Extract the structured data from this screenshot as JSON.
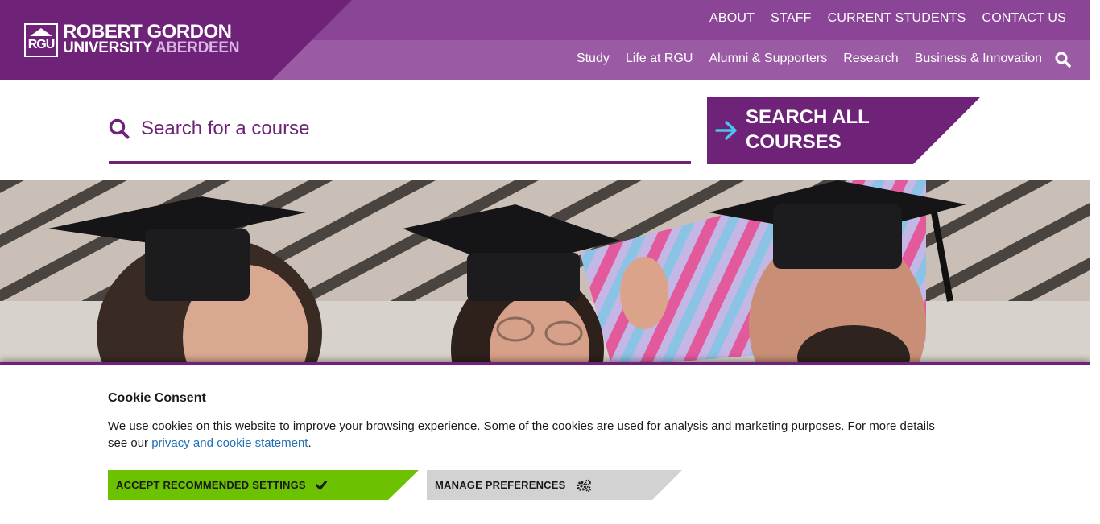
{
  "brand": {
    "logo_mark": "RGU",
    "name_line1": "ROBERT GORDON",
    "name_line2a": "UNIVERSITY",
    "name_line2b": "ABERDEEN",
    "colors": {
      "primary": "#6e2378",
      "nav_bg": "#9a5aa4",
      "accent_green": "#6cc100",
      "arrow_blue": "#4cc3ee"
    }
  },
  "top_nav": [
    "ABOUT",
    "STAFF",
    "CURRENT STUDENTS",
    "CONTACT US"
  ],
  "main_nav": [
    "Study",
    "Life at RGU",
    "Alumni & Supporters",
    "Research",
    "Business & Innovation"
  ],
  "icons": {
    "nav_search": "search-icon",
    "course_search": "search-icon",
    "search_all": "arrow-right-icon",
    "accept": "check-icon",
    "manage": "gears-icon"
  },
  "course_search": {
    "placeholder": "Search for a course",
    "button_label": "SEARCH ALL COURSES"
  },
  "cookie": {
    "title": "Cookie Consent",
    "text_before": "We use cookies on this website to improve your browsing experience. Some of the cookies are used for analysis and marketing purposes. For more details see our ",
    "link_text": "privacy and cookie statement",
    "text_after": ".",
    "accept_label": "ACCEPT RECOMMENDED SETTINGS",
    "manage_label": "MANAGE PREFERENCES"
  }
}
